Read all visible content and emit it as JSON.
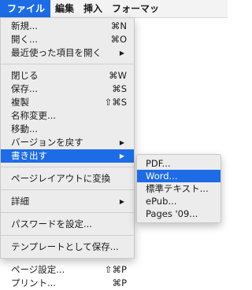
{
  "menubar": {
    "items": [
      "ファイル",
      "編集",
      "挿入",
      "フォーマッ"
    ]
  },
  "file_menu": {
    "items": [
      {
        "label": "新規...",
        "shortcut": "⌘N"
      },
      {
        "label": "開く...",
        "shortcut": "⌘O"
      },
      {
        "label": "最近使った項目を開く",
        "arrow": "▶"
      },
      {
        "label": "閉じる",
        "shortcut": "⌘W"
      },
      {
        "label": "保存...",
        "shortcut": "⌘S"
      },
      {
        "label": "複製",
        "shortcut": "⇧⌘S"
      },
      {
        "label": "名称変更..."
      },
      {
        "label": "移動..."
      },
      {
        "label": "バージョンを戻す",
        "arrow": "▶"
      },
      {
        "label": "書き出す",
        "arrow": "▶"
      },
      {
        "label": "ページレイアウトに変換"
      },
      {
        "label": "詳細",
        "arrow": "▶"
      },
      {
        "label": "パスワードを設定..."
      },
      {
        "label": "テンプレートとして保存..."
      },
      {
        "label": "ページ設定...",
        "shortcut": "⇧⌘P"
      },
      {
        "label": "プリント...",
        "shortcut": "⌘P"
      }
    ]
  },
  "export_submenu": {
    "items": [
      "PDF...",
      "Word...",
      "標準テキスト...",
      "ePub...",
      "Pages '09..."
    ]
  },
  "colors": {
    "highlight": "#1d6ce6",
    "menu_bg": "#ececec"
  }
}
